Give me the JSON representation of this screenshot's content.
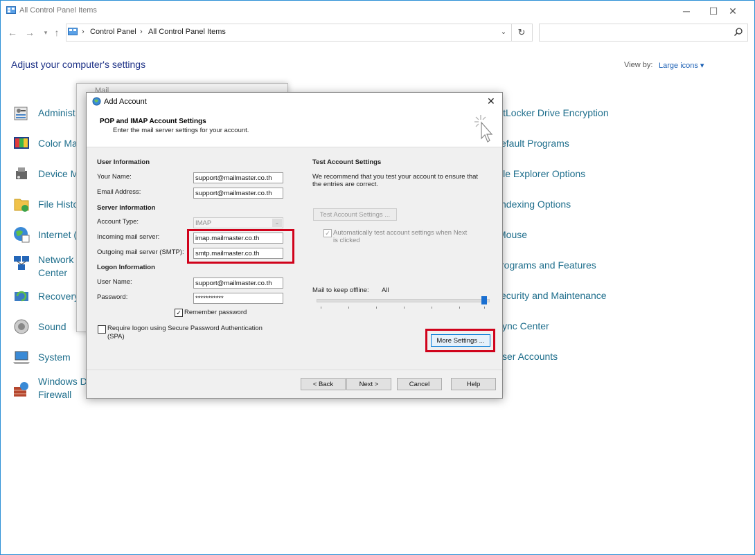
{
  "window": {
    "title": "All Control Panel Items",
    "minimize_label": "─",
    "maximize_label": "☐",
    "close_label": "✕"
  },
  "address": {
    "crumbs": [
      "Control Panel",
      "All Control Panel Items"
    ],
    "separator": "›",
    "search_placeholder": ""
  },
  "content": {
    "heading": "Adjust your computer's settings",
    "view_by_label": "View by:",
    "view_by_value": "Large icons ▾",
    "left_items": [
      "Administ",
      "Color Ma",
      "Device M",
      "File Histo",
      "Internet (",
      "Network",
      "Recovery",
      "Sound",
      "System",
      "Windows D"
    ],
    "left_items_line2": {
      "network": "Center",
      "windows": "Firewall"
    },
    "right_items": [
      "itLocker Drive Encryption",
      "efault Programs",
      "ile Explorer Options",
      "ndexing Options",
      "Mouse",
      "rograms and Features",
      "ecurity and Maintenance",
      "ync Center",
      "ser Accounts"
    ]
  },
  "mail_dialog": {
    "title": "Mail"
  },
  "add_account": {
    "title": "Add Account",
    "header": "POP and IMAP Account Settings",
    "subheader": "Enter the mail server settings for your account.",
    "user_info": "User Information",
    "your_name_label": "Your Name:",
    "your_name": "support@mailmaster.co.th",
    "email_label": "Email Address:",
    "email": "support@mailmaster.co.th",
    "server_info": "Server Information",
    "account_type_label": "Account Type:",
    "account_type": "IMAP",
    "incoming_label": "Incoming mail server:",
    "incoming": "imap.mailmaster.co.th",
    "outgoing_label": "Outgoing mail server (SMTP):",
    "outgoing": "smtp.mailmaster.co.th",
    "logon_info": "Logon Information",
    "username_label": "User Name:",
    "username": "support@mailmaster.co.th",
    "password_label": "Password:",
    "password": "***********",
    "remember_password": "Remember password",
    "spa_line1": "Require logon using Secure Password Authentication",
    "spa_line2": "(SPA)",
    "test_header": "Test Account Settings",
    "test_desc1": "We recommend that you test your account to ensure that",
    "test_desc2": "the entries are correct.",
    "test_button": "Test Account Settings ...",
    "auto_test1": "Automatically test account settings when Next",
    "auto_test2": "is clicked",
    "offline_label": "Mail to keep offline:",
    "offline_value": "All",
    "offline_level": 1.0,
    "more_settings": "More Settings ...",
    "back": "< Back",
    "next": "Next >",
    "cancel": "Cancel",
    "help": "Help",
    "close_label": "✕"
  },
  "colors": {
    "accent": "#0078d7",
    "highlight": "#d0021b",
    "link": "#1e6e8c"
  }
}
